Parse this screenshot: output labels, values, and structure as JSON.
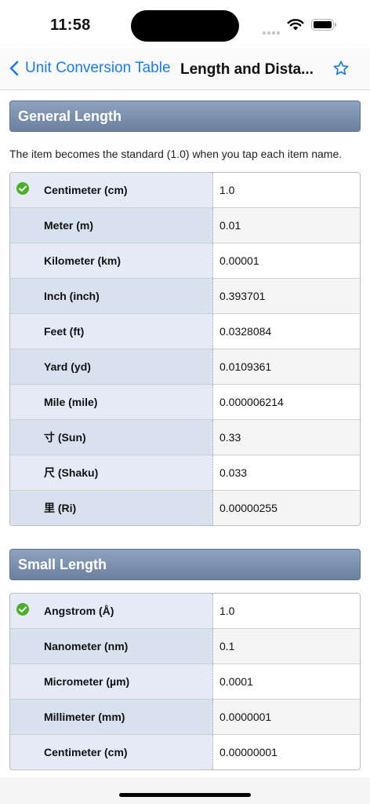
{
  "status": {
    "time": "11:58"
  },
  "nav": {
    "back_label": "Unit Conversion Table",
    "title": "Length and Dista..."
  },
  "sections": [
    {
      "title": "General Length",
      "note": "The item becomes the standard (1.0) when you tap each item name.",
      "rows": [
        {
          "name": "Centimeter (cm)",
          "value": "1.0",
          "selected": true
        },
        {
          "name": "Meter (m)",
          "value": "0.01"
        },
        {
          "name": "Kilometer (km)",
          "value": "0.00001"
        },
        {
          "name": "Inch (inch)",
          "value": "0.393701"
        },
        {
          "name": "Feet (ft)",
          "value": "0.0328084"
        },
        {
          "name": "Yard (yd)",
          "value": "0.0109361"
        },
        {
          "name": "Mile (mile)",
          "value": "0.000006214"
        },
        {
          "name": "寸 (Sun)",
          "value": "0.33"
        },
        {
          "name": "尺 (Shaku)",
          "value": "0.033"
        },
        {
          "name": "里 (Ri)",
          "value": "0.00000255"
        }
      ]
    },
    {
      "title": "Small Length",
      "rows": [
        {
          "name": "Angstrom (Å)",
          "value": "1.0",
          "selected": true
        },
        {
          "name": "Nanometer (nm)",
          "value": "0.1"
        },
        {
          "name": "Micrometer (µm)",
          "value": "0.0001"
        },
        {
          "name": "Millimeter (mm)",
          "value": "0.0000001"
        },
        {
          "name": "Centimeter (cm)",
          "value": "0.00000001"
        }
      ]
    }
  ],
  "colors": {
    "accent": "#1a7bf0",
    "check": "#4caf2a",
    "header": "#7a8fad"
  }
}
